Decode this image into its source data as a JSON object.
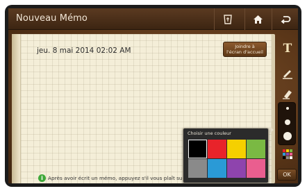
{
  "app": {
    "title": "Nouveau Mémo"
  },
  "toolbar": {
    "icons": [
      "clear-memo-icon",
      "home-icon",
      "back-icon"
    ]
  },
  "memo": {
    "date": "jeu. 8 mai 2014 02:02 AM",
    "home_button_label": "Joindre à\nl'écran d'accueil",
    "hint_icon": "i",
    "hint_text": "Après avoir écrit un mémo, appuyez s'il vous plaît sur"
  },
  "tools": {
    "items": [
      "text-tool-icon",
      "pen-tool-icon",
      "eraser-tool-icon",
      "stroke-size-selector",
      "color-palette-icon"
    ]
  },
  "color_picker": {
    "title": "Choisir une couleur",
    "colors": [
      "#000000",
      "#e8232a",
      "#f5d000",
      "#7ab943",
      "#8a8a8a",
      "#2a9ad6",
      "#8e44ad",
      "#ea5e8f"
    ],
    "selected_index": 0
  },
  "ok_label": "OK"
}
